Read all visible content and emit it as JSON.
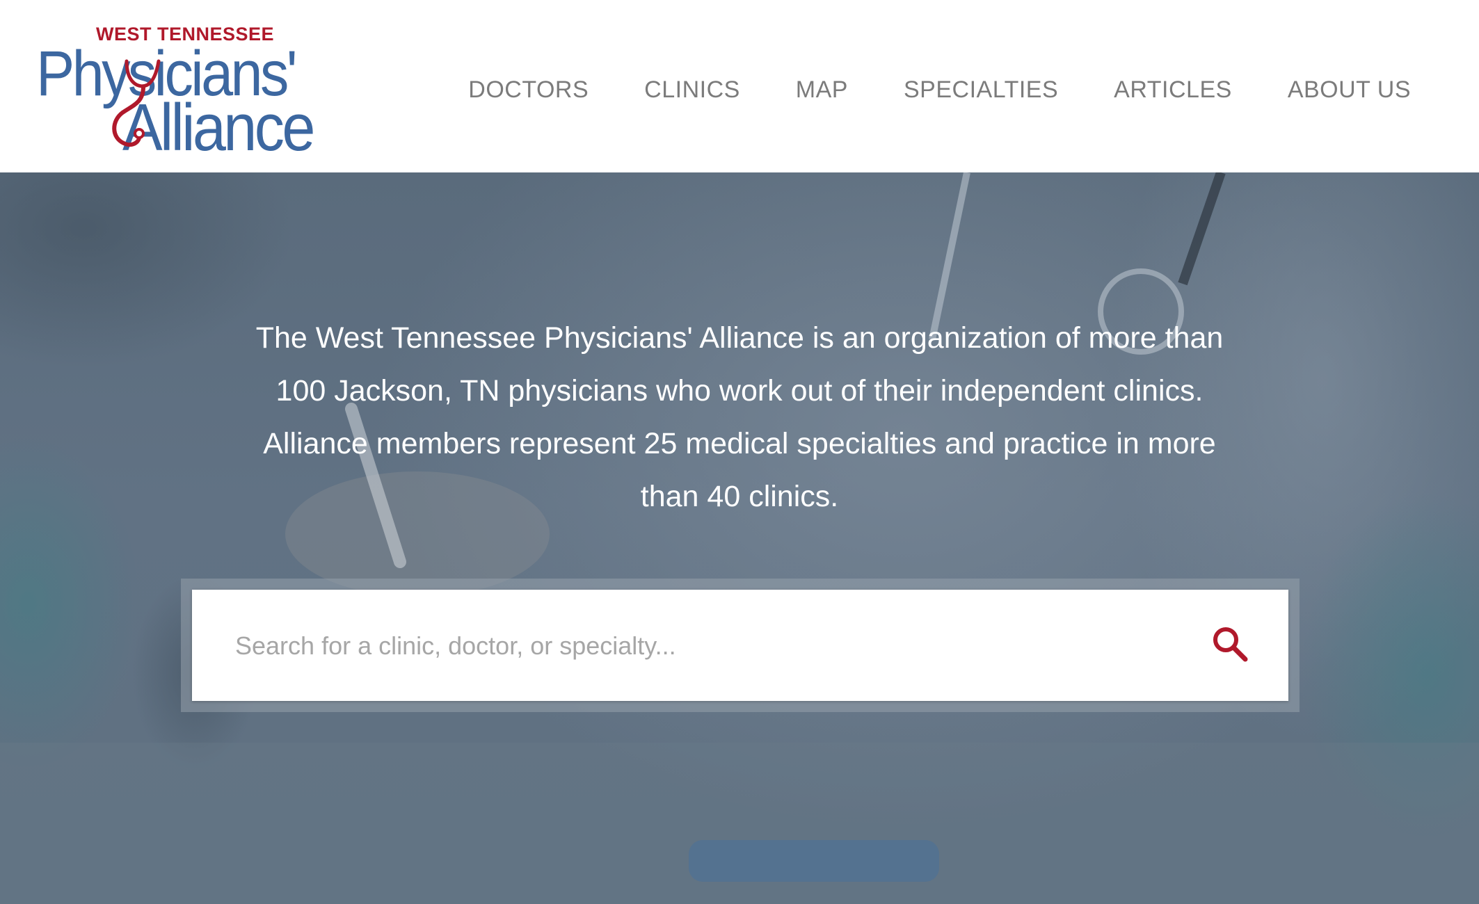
{
  "logo": {
    "top_text": "WEST TENNESSEE",
    "line1": "Physicians'",
    "line2": "Alliance"
  },
  "nav": {
    "items": [
      {
        "label": "DOCTORS"
      },
      {
        "label": "CLINICS"
      },
      {
        "label": "MAP"
      },
      {
        "label": "SPECIALTIES"
      },
      {
        "label": "ARTICLES"
      },
      {
        "label": "ABOUT US"
      }
    ]
  },
  "hero": {
    "lines": [
      "The West Tennessee Physicians' Alliance is an organization of more than",
      "100 Jackson, TN physicians who work out of their independent clinics.",
      "Alliance members represent 25 medical specialties and practice in more",
      "than 40 clinics."
    ]
  },
  "search": {
    "placeholder": "Search for a clinic, doctor, or specialty..."
  },
  "colors": {
    "brand_blue": "#3c67a0",
    "brand_red": "#b0192b",
    "nav_text": "#7b7b7b",
    "hero_overlay": "#5f7081"
  }
}
